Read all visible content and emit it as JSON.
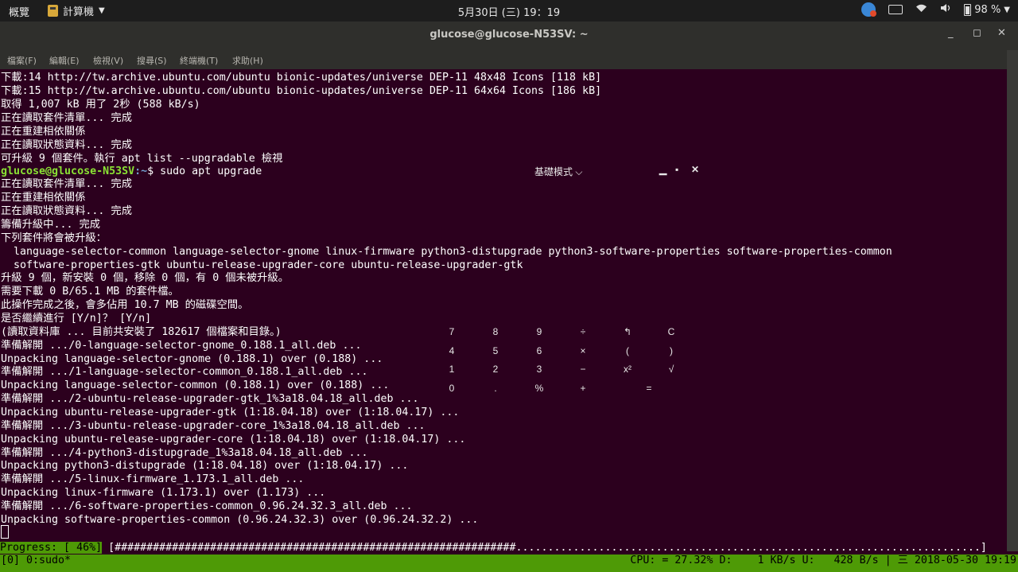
{
  "topbar": {
    "activities": "概覽",
    "app_name": "計算機",
    "clock": "5月30日 (三) 19：19",
    "battery": "98 %"
  },
  "window": {
    "title": "glucose@glucose-N53SV: ~",
    "minimize": "_",
    "maximize": "◻",
    "close": "✕"
  },
  "menu": [
    "檔案(F)",
    "編輯(E)",
    "檢視(V)",
    "搜尋(S)",
    "終端機(T)",
    "求助(H)"
  ],
  "terminal": {
    "lines_before": [
      "下載:14 http://tw.archive.ubuntu.com/ubuntu bionic-updates/universe DEP-11 48x48 Icons [118 kB]",
      "下載:15 http://tw.archive.ubuntu.com/ubuntu bionic-updates/universe DEP-11 64x64 Icons [186 kB]",
      "取得 1,007 kB 用了 2秒 (588 kB/s)",
      "正在讀取套件清單... 完成",
      "正在重建相依關係",
      "正在讀取狀態資料... 完成",
      "可升級 9 個套件。執行 apt list --upgradable 檢視"
    ],
    "prompt_user": "glucose@glucose-N53SV",
    "prompt_path": ":~",
    "prompt_cmd": "$ sudo apt upgrade",
    "lines_after": [
      "正在讀取套件清單... 完成",
      "正在重建相依關係",
      "正在讀取狀態資料... 完成",
      "籌備升級中... 完成",
      "下列套件將會被升級：",
      "  language-selector-common language-selector-gnome linux-firmware python3-distupgrade python3-software-properties software-properties-common",
      "  software-properties-gtk ubuntu-release-upgrader-core ubuntu-release-upgrader-gtk",
      "升級 9 個，新安裝 0 個，移除 0 個，有 0 個未被升級。",
      "需要下載 0 B/65.1 MB 的套件檔。",
      "此操作完成之後，會多佔用 10.7 MB 的磁碟空間。",
      "是否繼續進行 [Y/n]？ [Y/n]",
      "(讀取資料庫 ... 目前共安裝了 182617 個檔案和目錄。)",
      "準備解開 .../0-language-selector-gnome_0.188.1_all.deb ...",
      "Unpacking language-selector-gnome (0.188.1) over (0.188) ...",
      "準備解開 .../1-language-selector-common_0.188.1_all.deb ...",
      "Unpacking language-selector-common (0.188.1) over (0.188) ...",
      "準備解開 .../2-ubuntu-release-upgrader-gtk_1%3a18.04.18_all.deb ...",
      "Unpacking ubuntu-release-upgrader-gtk (1:18.04.18) over (1:18.04.17) ...",
      "準備解開 .../3-ubuntu-release-upgrader-core_1%3a18.04.18_all.deb ...",
      "Unpacking ubuntu-release-upgrader-core (1:18.04.18) over (1:18.04.17) ...",
      "準備解開 .../4-python3-distupgrade_1%3a18.04.18_all.deb ...",
      "Unpacking python3-distupgrade (1:18.04.18) over (1:18.04.17) ...",
      "準備解開 .../5-linux-firmware_1.173.1_all.deb ...",
      "Unpacking linux-firmware (1.173.1) over (1.173) ...",
      "準備解開 .../6-software-properties-common_0.96.24.32.3_all.deb ...",
      "Unpacking software-properties-common (0.96.24.32.3) over (0.96.24.32.2) ..."
    ]
  },
  "progress": {
    "label": "Progress: [ 46%]",
    "bar": " [###############################################################.........................................................................]",
    "percent": 46
  },
  "tmux": {
    "left": "[0] 0:sudo*",
    "right": "CPU: = 27.32% D:    1 KB/s U:   428 B/s | 三 2018-05-30 19:19"
  },
  "calculator": {
    "mode": "基礎模式",
    "keys": [
      [
        "7",
        "8",
        "9",
        "÷",
        "↰",
        "C"
      ],
      [
        "4",
        "5",
        "6",
        "×",
        "(",
        ")"
      ],
      [
        "1",
        "2",
        "3",
        "−",
        "x²",
        "√"
      ],
      [
        "0",
        ".",
        "%",
        "+",
        "",
        "="
      ]
    ]
  },
  "colors": {
    "terminal_bg": "#2c001e",
    "prompt_user": "#8ae234",
    "prompt_path": "#729fcf",
    "tmux_bar": "#4e9a06"
  }
}
